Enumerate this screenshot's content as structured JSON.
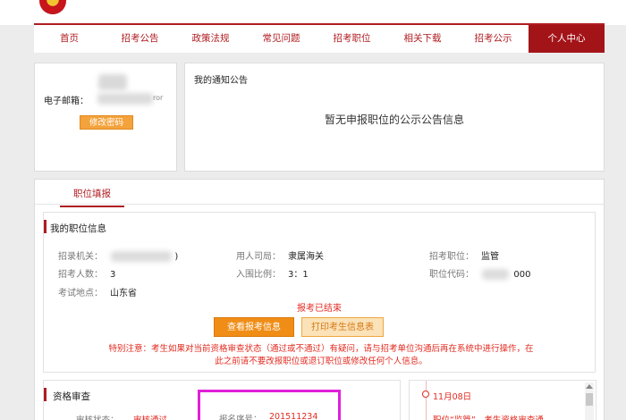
{
  "nav": {
    "items": [
      "首页",
      "招考公告",
      "政策法规",
      "常见问题",
      "招考职位",
      "相关下载",
      "招考公示",
      "个人中心"
    ],
    "active_index": 7
  },
  "profile": {
    "email_label": "电子邮箱：",
    "email_tail": "ror",
    "change_password_label": "修改密码"
  },
  "notice": {
    "title": "我的通知公告",
    "empty_message": "暂无申报职位的公示公告信息"
  },
  "tabs": {
    "active_label": "职位填报"
  },
  "job": {
    "title": "我的职位信息",
    "org_label": "招录机关：",
    "org_tail": ")",
    "employer_label": "用人司局：",
    "employer_value": "隶属海关",
    "position_label": "招考职位：",
    "position_value": "监管",
    "count_label": "招考人数：",
    "count_value": "3",
    "ratio_label": "入围比例：",
    "ratio_value": "3：1",
    "code_label": "职位代码：",
    "code_tail": "000",
    "location_label": "考试地点：",
    "location_value": "山东省",
    "status": "报考已结束",
    "view_button": "查看报考信息",
    "print_button": "打印考生信息表",
    "warning_line1": "特别注意：考生如果对当前资格审查状态（通过或不通过）有疑问，请与招考单位沟通后再在系统中进行操作，在",
    "warning_line2": "此之前请不要改报职位或退订职位或修改任何个人信息。"
  },
  "review": {
    "title": "资格审查",
    "status_label": "审核状态：",
    "status_value": "审核通过",
    "reg_label": "报名序号：",
    "reg_value": "201511234"
  },
  "news": {
    "date": "11月08日",
    "text": "职位“监管”，考生资格审查通"
  },
  "colors": {
    "brand_red": "#b01c21",
    "nav_active": "#a31419",
    "orange_button": "#f08d16",
    "warning_red": "#e32b21",
    "highlight_magenta": "#e020d8"
  }
}
